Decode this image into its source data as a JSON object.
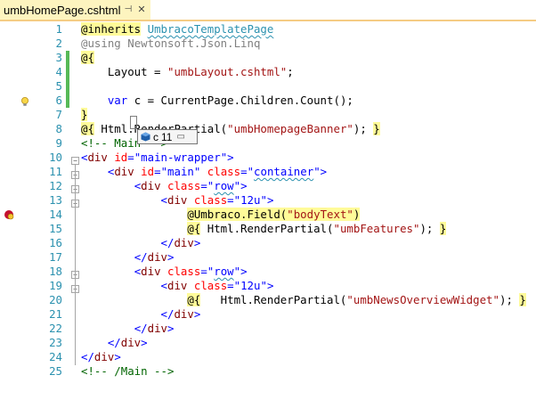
{
  "tab": {
    "filename": "umbHomePage.cshtml",
    "pin_glyph": "⊣",
    "close_glyph": "✕"
  },
  "datatip": {
    "name": "c",
    "value": "11",
    "icon": "local-variable-icon"
  },
  "lines": [
    {
      "n": "1",
      "parts": [
        [
          "razor",
          "@inherits"
        ],
        [
          "d",
          " "
        ],
        [
          "t",
          "UmbracoTemplatePage"
        ]
      ]
    },
    {
      "n": "2",
      "parts": [
        [
          "grayr",
          "@using"
        ],
        [
          "d",
          " "
        ],
        [
          "gray",
          "Newtonsoft.Json.Linq"
        ]
      ]
    },
    {
      "n": "3",
      "parts": [
        [
          "razor",
          "@{"
        ]
      ]
    },
    {
      "n": "4",
      "parts": [
        [
          "d",
          "    Layout = "
        ],
        [
          "s",
          "\"umbLayout.cshtml\""
        ],
        [
          "d",
          ";"
        ]
      ]
    },
    {
      "n": "5",
      "parts": [
        [
          "d",
          ""
        ]
      ]
    },
    {
      "n": "6",
      "parts": [
        [
          "k",
          "    var "
        ],
        [
          "d",
          "c = CurrentPage.Children.Count();"
        ]
      ]
    },
    {
      "n": "7",
      "parts": [
        [
          "razor",
          "}"
        ]
      ]
    },
    {
      "n": "8",
      "parts": [
        [
          "razor",
          "@{"
        ],
        [
          "d",
          " Html.RenderPartial("
        ],
        [
          "s",
          "\"umbHomepageBanner\""
        ],
        [
          "d",
          "); "
        ],
        [
          "razor",
          "}"
        ]
      ]
    },
    {
      "n": "9",
      "parts": [
        [
          "cmt",
          "<!-- Main -->"
        ]
      ]
    },
    {
      "n": "10",
      "parts": [
        [
          "k",
          "<"
        ],
        [
          "tag",
          "div"
        ],
        [
          "d",
          " "
        ],
        [
          "attr",
          "id"
        ],
        [
          "k",
          "="
        ],
        [
          "k",
          "\"main-wrapper\""
        ],
        [
          "k",
          ">"
        ]
      ]
    },
    {
      "n": "11",
      "parts": [
        [
          "d",
          "    "
        ],
        [
          "k",
          "<"
        ],
        [
          "tag",
          "div"
        ],
        [
          "d",
          " "
        ],
        [
          "attr",
          "id"
        ],
        [
          "k",
          "="
        ],
        [
          "k",
          "\"main\""
        ],
        [
          "d",
          " "
        ],
        [
          "attr",
          "class"
        ],
        [
          "k",
          "="
        ],
        [
          "k",
          "\""
        ],
        [
          "ksq",
          "container"
        ],
        [
          "k",
          "\""
        ],
        [
          "k",
          ">"
        ]
      ]
    },
    {
      "n": "12",
      "parts": [
        [
          "d",
          "        "
        ],
        [
          "k",
          "<"
        ],
        [
          "tag",
          "div"
        ],
        [
          "d",
          " "
        ],
        [
          "attr",
          "class"
        ],
        [
          "k",
          "="
        ],
        [
          "k",
          "\""
        ],
        [
          "ksq",
          "row"
        ],
        [
          "k",
          "\""
        ],
        [
          "k",
          ">"
        ]
      ]
    },
    {
      "n": "13",
      "parts": [
        [
          "d",
          "            "
        ],
        [
          "k",
          "<"
        ],
        [
          "tag",
          "div"
        ],
        [
          "d",
          " "
        ],
        [
          "attr",
          "class"
        ],
        [
          "k",
          "="
        ],
        [
          "k",
          "\"12u\""
        ],
        [
          "k",
          ">"
        ]
      ]
    },
    {
      "n": "14",
      "parts": [
        [
          "d",
          "                "
        ],
        [
          "razor",
          "@Umbraco"
        ],
        [
          "hl",
          ".Field("
        ],
        [
          "hls",
          "\"bodyText\""
        ],
        [
          "hl",
          ")"
        ]
      ]
    },
    {
      "n": "15",
      "parts": [
        [
          "d",
          "                "
        ],
        [
          "razor",
          "@{"
        ],
        [
          "d",
          " Html.RenderPartial("
        ],
        [
          "s",
          "\"umbFeatures\""
        ],
        [
          "d",
          "); "
        ],
        [
          "razor",
          "}"
        ]
      ]
    },
    {
      "n": "16",
      "parts": [
        [
          "d",
          "            "
        ],
        [
          "k",
          "</"
        ],
        [
          "tag",
          "div"
        ],
        [
          "k",
          ">"
        ]
      ]
    },
    {
      "n": "17",
      "parts": [
        [
          "d",
          "        "
        ],
        [
          "k",
          "</"
        ],
        [
          "tag",
          "div"
        ],
        [
          "k",
          ">"
        ]
      ]
    },
    {
      "n": "18",
      "parts": [
        [
          "d",
          "        "
        ],
        [
          "k",
          "<"
        ],
        [
          "tag",
          "div"
        ],
        [
          "d",
          " "
        ],
        [
          "attr",
          "class"
        ],
        [
          "k",
          "="
        ],
        [
          "k",
          "\""
        ],
        [
          "ksq",
          "row"
        ],
        [
          "k",
          "\""
        ],
        [
          "k",
          ">"
        ]
      ]
    },
    {
      "n": "19",
      "parts": [
        [
          "d",
          "            "
        ],
        [
          "k",
          "<"
        ],
        [
          "tag",
          "div"
        ],
        [
          "d",
          " "
        ],
        [
          "attr",
          "class"
        ],
        [
          "k",
          "="
        ],
        [
          "k",
          "\"12u\""
        ],
        [
          "k",
          ">"
        ]
      ]
    },
    {
      "n": "20",
      "parts": [
        [
          "d",
          "                "
        ],
        [
          "razor",
          "@{"
        ],
        [
          "d",
          "   Html.RenderPartial("
        ],
        [
          "s",
          "\"umbNewsOverviewWidget\""
        ],
        [
          "d",
          "); "
        ],
        [
          "razor",
          "}"
        ]
      ]
    },
    {
      "n": "21",
      "parts": [
        [
          "d",
          "            "
        ],
        [
          "k",
          "</"
        ],
        [
          "tag",
          "div"
        ],
        [
          "k",
          ">"
        ]
      ]
    },
    {
      "n": "22",
      "parts": [
        [
          "d",
          "        "
        ],
        [
          "k",
          "</"
        ],
        [
          "tag",
          "div"
        ],
        [
          "k",
          ">"
        ]
      ]
    },
    {
      "n": "23",
      "parts": [
        [
          "d",
          "    "
        ],
        [
          "k",
          "</"
        ],
        [
          "tag",
          "div"
        ],
        [
          "k",
          ">"
        ]
      ]
    },
    {
      "n": "24",
      "parts": [
        [
          "k",
          "</"
        ],
        [
          "tag",
          "div"
        ],
        [
          "k",
          ">"
        ]
      ]
    },
    {
      "n": "25",
      "parts": [
        [
          "cmt",
          "<!-- /Main -->"
        ]
      ]
    }
  ]
}
